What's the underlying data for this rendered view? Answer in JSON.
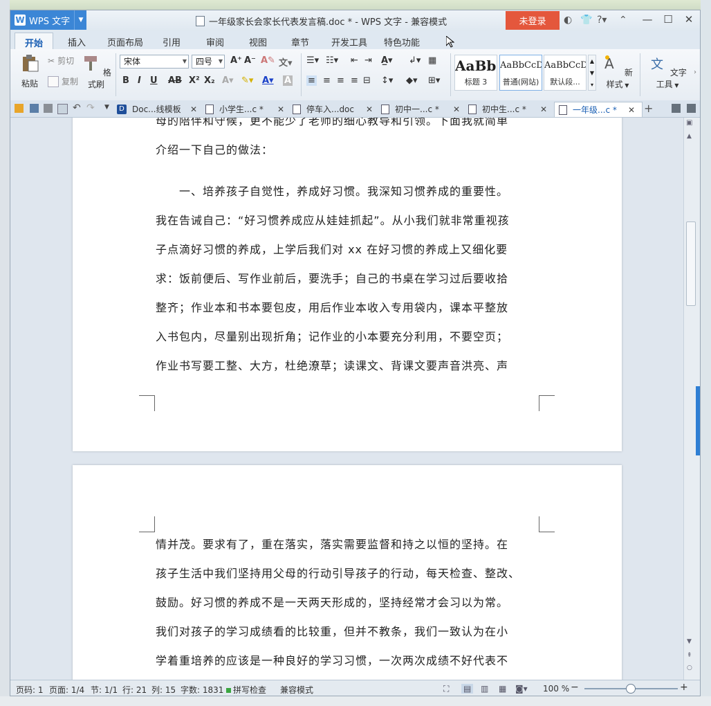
{
  "app": {
    "name": "WPS 文字",
    "logo": "W"
  },
  "window": {
    "title": "一年级家长会家长代表发言稿.doc * - WPS 文字 - 兼容模式",
    "login_label": "未登录",
    "minimize": "—",
    "maximize": "☐",
    "close": "✕"
  },
  "menu": {
    "tabs": [
      "开始",
      "插入",
      "页面布局",
      "引用",
      "审阅",
      "视图",
      "章节",
      "开发工具",
      "特色功能"
    ]
  },
  "ribbon": {
    "paste": "粘贴",
    "cut": "剪切",
    "copy": "复制",
    "format_painter": "格式刷",
    "font_name": "宋体",
    "font_size": "四号",
    "bold": "B",
    "italic": "I",
    "underline": "U",
    "strike": "AB",
    "superscript": "X²",
    "subscript": "X₂",
    "styles": [
      {
        "preview": "AaBbC",
        "label": "标题 3"
      },
      {
        "preview": "AaBbCcDd",
        "label": "普通(网站)"
      },
      {
        "preview": "AaBbCcDd",
        "label": "默认段..."
      }
    ],
    "new_style": "新样式",
    "text_tools": "文字工具"
  },
  "doc_tabs": [
    {
      "label": "Doc...线模板"
    },
    {
      "label": "小学生...c *"
    },
    {
      "label": "停车入...doc"
    },
    {
      "label": "初中一...c *"
    },
    {
      "label": "初中生...c *"
    },
    {
      "label": "一年级...c *"
    }
  ],
  "page1": {
    "lines": [
      "母的陪伴和守候，更不能少了老师的细心教导和引领。下面我就简单",
      "介绍一下自己的做法："
    ],
    "para2": [
      "　　一、培养孩子自觉性，养成好习惯。我深知习惯养成的重要性。",
      "我在告诫自己：“好习惯养成应从娃娃抓起”。从小我们就非常重视孩",
      "子点滴好习惯的养成，上学后我们对 xx 在好习惯的养成上又细化要",
      "求：饭前便后、写作业前后，要洗手；自己的书桌在学习过后要收拾",
      "整齐；作业本和书本要包皮，用后作业本收入专用袋内，课本平整放",
      "入书包内，尽量别出现折角；记作业的小本要充分利用，不要空页；",
      "作业书写要工整、大方，杜绝潦草；读课文、背课文要声音洪亮、声"
    ]
  },
  "page2": {
    "lines": [
      "情并茂。要求有了，重在落实，落实需要监督和持之以恒的坚持。在",
      "孩子生活中我们坚持用父母的行动引导孩子的行动，每天检查、整改、",
      "鼓励。好习惯的养成不是一天两天形成的，坚持经常才会习以为常。",
      "我们对孩子的学习成绩看的比较重，但并不教条，我们一致认为在小",
      "学着重培养的应该是一种良好的学习习惯，一次两次成绩不好代表不"
    ]
  },
  "status": {
    "page_code": "页码: 1",
    "page": "页面: 1/4",
    "section": "节: 1/1",
    "row": "行: 21",
    "col": "列: 15",
    "words": "字数: 1831",
    "spell": "拼写检查",
    "compat": "兼容模式",
    "zoom": "100 %",
    "zoom_level": 100
  }
}
